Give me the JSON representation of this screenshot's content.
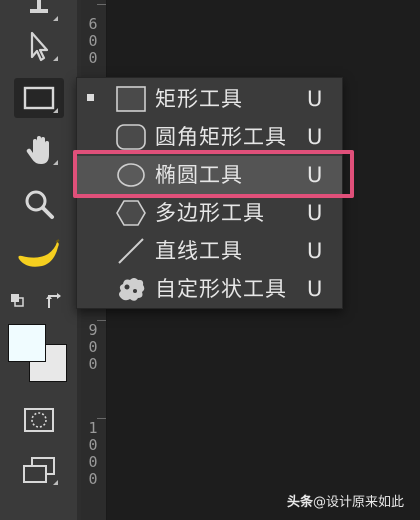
{
  "ruler": {
    "marks": [
      {
        "text": "6\n0\n0"
      },
      {
        "text": "9\n0\n0"
      },
      {
        "text": "1\n0\n0\n0"
      }
    ]
  },
  "toolbar": {
    "tools": [
      {
        "name": "move-icon"
      },
      {
        "name": "selection-arrow-icon"
      },
      {
        "name": "rectangle-shape-icon",
        "active": true
      },
      {
        "name": "hand-icon"
      },
      {
        "name": "zoom-icon"
      },
      {
        "name": "banana-icon"
      },
      {
        "name": "swap-colors-icon"
      },
      {
        "name": "quick-mask-icon"
      },
      {
        "name": "screen-mode-icon"
      }
    ],
    "foreground_color": "#f0fcff",
    "background_color": "#e8e8e8"
  },
  "flyout": {
    "items": [
      {
        "label": "矩形工具",
        "shortcut": "U",
        "icon": "rectangle-icon",
        "current": true
      },
      {
        "label": "圆角矩形工具",
        "shortcut": "U",
        "icon": "rounded-rectangle-icon"
      },
      {
        "label": "椭圆工具",
        "shortcut": "U",
        "icon": "ellipse-icon",
        "highlighted": true
      },
      {
        "label": "多边形工具",
        "shortcut": "U",
        "icon": "polygon-icon"
      },
      {
        "label": "直线工具",
        "shortcut": "U",
        "icon": "line-icon"
      },
      {
        "label": "自定形状工具",
        "shortcut": "U",
        "icon": "custom-shape-icon"
      }
    ]
  },
  "annotation": {
    "color": "#e0507a"
  },
  "watermark": {
    "prefix": "头条",
    "text": "@设计原来如此"
  }
}
